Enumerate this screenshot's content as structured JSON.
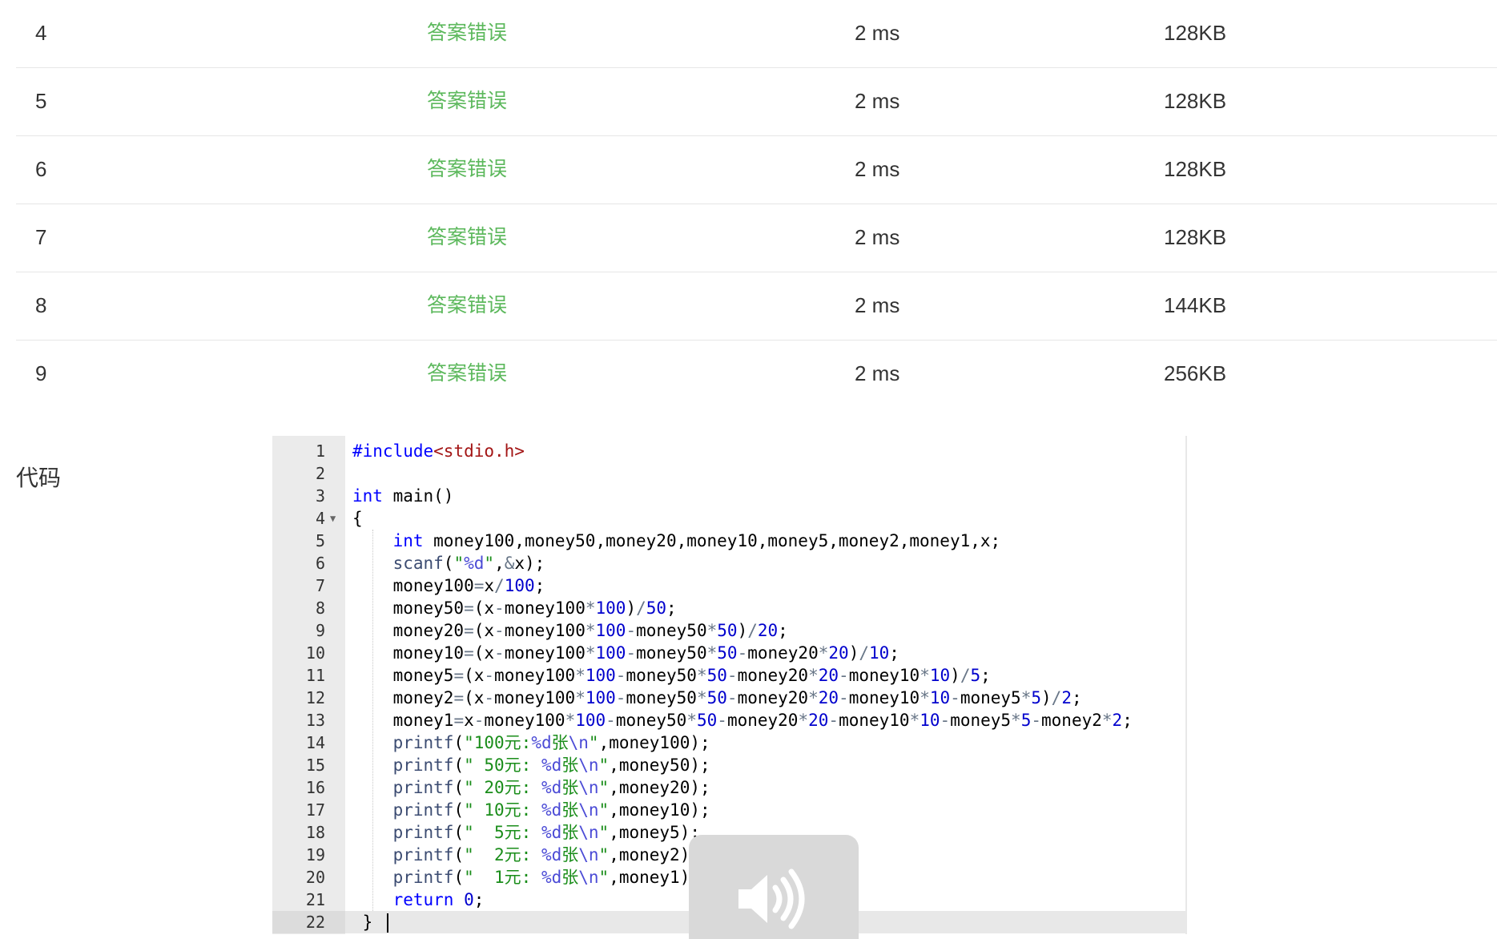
{
  "results": [
    {
      "index": "4",
      "status": "答案错误",
      "time": "2 ms",
      "memory": "128KB"
    },
    {
      "index": "5",
      "status": "答案错误",
      "time": "2 ms",
      "memory": "128KB"
    },
    {
      "index": "6",
      "status": "答案错误",
      "time": "2 ms",
      "memory": "128KB"
    },
    {
      "index": "7",
      "status": "答案错误",
      "time": "2 ms",
      "memory": "128KB"
    },
    {
      "index": "8",
      "status": "答案错误",
      "time": "2 ms",
      "memory": "144KB"
    },
    {
      "index": "9",
      "status": "答案错误",
      "time": "2 ms",
      "memory": "256KB"
    }
  ],
  "code_section": {
    "label": "代码",
    "lines": [
      "#include<stdio.h>",
      "",
      "int main()",
      "{",
      "    int money100,money50,money20,money10,money5,money2,money1,x;",
      "    scanf(\"%d\",&x);",
      "    money100=x/100;",
      "    money50=(x-money100*100)/50;",
      "    money20=(x-money100*100-money50*50)/20;",
      "    money10=(x-money100*100-money50*50-money20*20)/10;",
      "    money5=(x-money100*100-money50*50-money20*20-money10*10)/5;",
      "    money2=(x-money100*100-money50*50-money20*20-money10*10-money5*5)/2;",
      "    money1=x-money100*100-money50*50-money20*20-money10*10-money5*5-money2*2;",
      "    printf(\"100元:%d张\\n\",money100);",
      "    printf(\" 50元: %d张\\n\",money50);",
      "    printf(\" 20元: %d张\\n\",money20);",
      "    printf(\" 10元: %d张\\n\",money10);",
      "    printf(\"  5元: %d张\\n\",money5);",
      "    printf(\"  2元: %d张\\n\",money2);",
      "    printf(\"  1元: %d张\\n\",money1);",
      "    return 0;",
      " }"
    ],
    "active_line": 22
  },
  "colors": {
    "status_wrong": "#5cb85c",
    "keyword": "#0000ff",
    "string": "#1a8d1a",
    "number": "#0000cd"
  },
  "icons": {
    "volume": "speaker-icon"
  }
}
